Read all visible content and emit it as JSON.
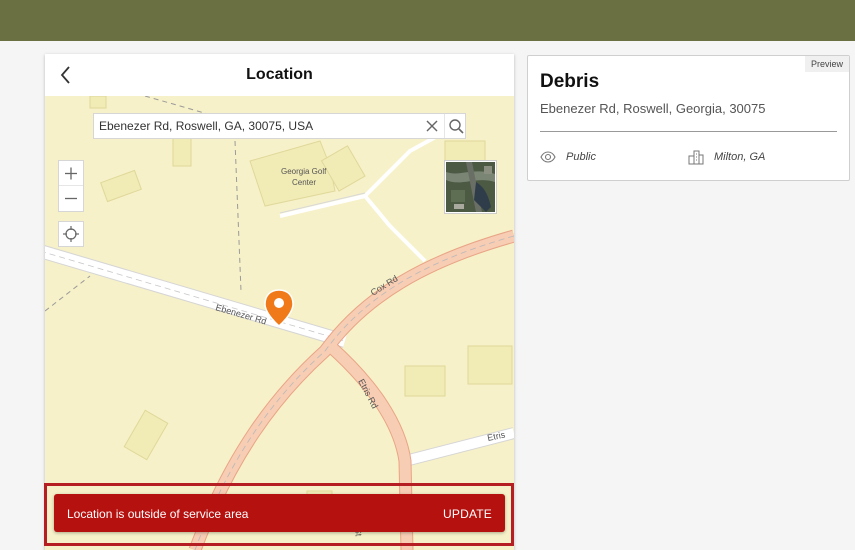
{
  "header": {
    "bar_color": "#6b7042"
  },
  "location_panel": {
    "title": "Location",
    "back_icon": "chevron-left-icon",
    "search": {
      "value": "Ebenezer Rd, Roswell, GA, 30075, USA",
      "clear_icon": "close-icon",
      "search_icon": "search-icon"
    },
    "controls": {
      "zoom_in_icon": "plus-icon",
      "zoom_out_icon": "minus-icon",
      "locate_icon": "crosshair-icon",
      "basemap_icon": "satellite-basemap-thumbnail"
    },
    "map_labels": {
      "poi": [
        "Georgia Golf",
        "Center"
      ],
      "roads": [
        "Ebenezer Rd",
        "Cox Rd",
        "Etris Rd",
        "Etris",
        "Rd",
        "St"
      ]
    },
    "marker_icon": "map-pin-icon",
    "marker_color": "#f07a1a",
    "alert": {
      "message": "Location is outside of service area",
      "action": "UPDATE",
      "color": "#b5110f"
    }
  },
  "preview_card": {
    "badge": "Preview",
    "title": "Debris",
    "address": "Ebenezer Rd, Roswell, Georgia, 30075",
    "visibility_icon": "eye-icon",
    "visibility": "Public",
    "jurisdiction_icon": "city-buildings-icon",
    "jurisdiction": "Milton, GA"
  }
}
